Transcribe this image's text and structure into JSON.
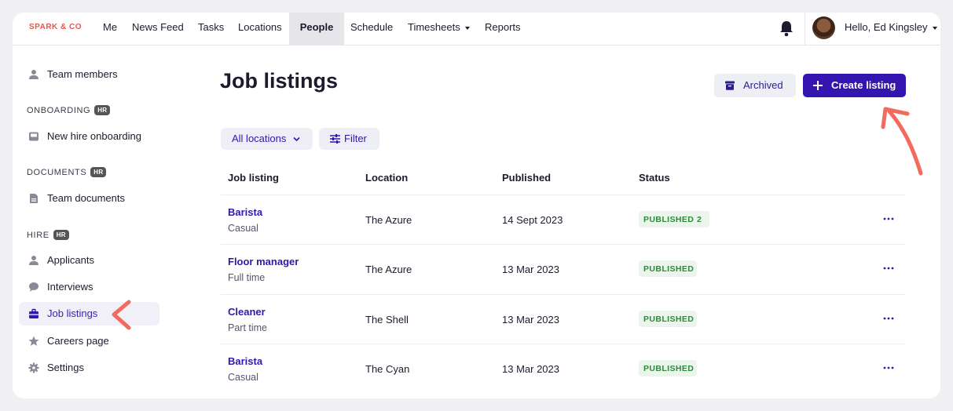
{
  "brand": "SPARK & CO",
  "nav": {
    "items": [
      "Me",
      "News Feed",
      "Tasks",
      "Locations",
      "People",
      "Schedule",
      "Timesheets",
      "Reports"
    ],
    "active": "People",
    "user_greeting": "Hello, Ed Kingsley"
  },
  "sidebar": {
    "team_members": "Team members",
    "onboarding_heading": "ONBOARDING",
    "new_hire": "New hire onboarding",
    "documents_heading": "DOCUMENTS",
    "team_documents": "Team documents",
    "hire_heading": "HIRE",
    "applicants": "Applicants",
    "interviews": "Interviews",
    "job_listings": "Job listings",
    "careers_page": "Careers page",
    "settings": "Settings",
    "hr_badge": "HR"
  },
  "main": {
    "title": "Job listings",
    "archived_label": "Archived",
    "create_label": "Create listing",
    "locations_filter": "All locations",
    "filter_label": "Filter"
  },
  "table": {
    "headers": [
      "Job listing",
      "Location",
      "Published",
      "Status"
    ],
    "rows": [
      {
        "name": "Barista",
        "type": "Casual",
        "location": "The Azure",
        "published": "14 Sept 2023",
        "status": "PUBLISHED",
        "count": "2"
      },
      {
        "name": "Floor manager",
        "type": "Full time",
        "location": "The Azure",
        "published": "13 Mar 2023",
        "status": "PUBLISHED",
        "count": ""
      },
      {
        "name": "Cleaner",
        "type": "Part time",
        "location": "The Shell",
        "published": "13 Mar 2023",
        "status": "PUBLISHED",
        "count": ""
      },
      {
        "name": "Barista",
        "type": "Casual",
        "location": "The Cyan",
        "published": "13 Mar 2023",
        "status": "PUBLISHED",
        "count": ""
      }
    ]
  },
  "colors": {
    "accent": "#3415b0",
    "annotation": "#f26b5e",
    "status_green": "#2a8a3a"
  }
}
